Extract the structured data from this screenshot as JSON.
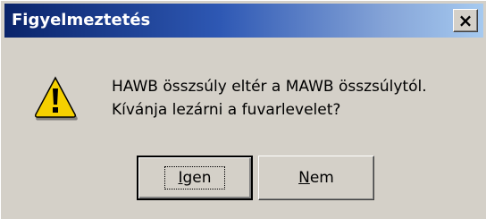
{
  "dialog": {
    "title": "Figyelmeztetés",
    "close_label": "×",
    "icon": "warning-icon",
    "message_lines": [
      "HAWB összsúly eltér a MAWB összsúlytól.",
      "Kívánja lezárni a fuvarlevelet?"
    ],
    "buttons": {
      "yes": "Igen",
      "no": "Nem"
    }
  },
  "colors": {
    "face": "#d4d0c8",
    "title_start": "#0a246a",
    "title_end": "#a6caf0",
    "warning_yellow": "#f5d000"
  }
}
